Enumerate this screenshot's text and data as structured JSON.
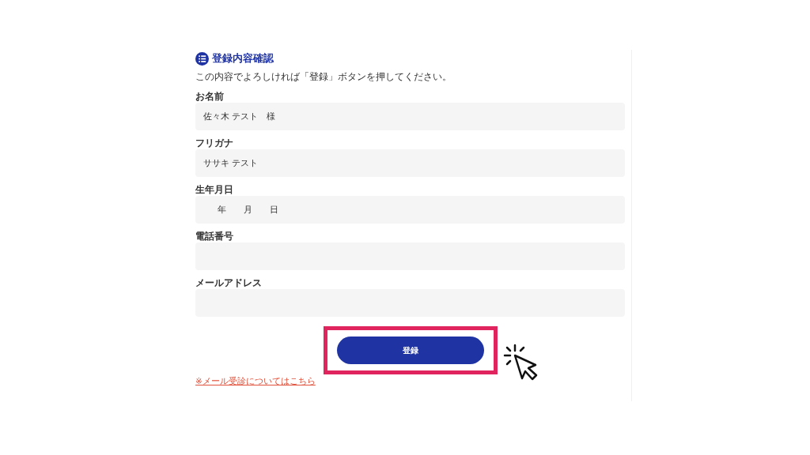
{
  "title": "登録内容確認",
  "description": "この内容でよろしければ「登録」ボタンを押してください。",
  "fields": [
    {
      "kind": "text",
      "label": "お名前",
      "value": "佐々木 テスト　様"
    },
    {
      "kind": "text",
      "label": "フリガナ",
      "value": "ササキ テスト"
    },
    {
      "kind": "date",
      "label": "生年月日",
      "parts": [
        "年",
        "月",
        "日"
      ]
    },
    {
      "kind": "text",
      "label": "電話番号"
    },
    {
      "kind": "text",
      "label": "メールアドレス"
    }
  ],
  "submit_button": {
    "label": "登録",
    "highlighted": true
  },
  "mail_link": "※メール受診についてはこちら"
}
